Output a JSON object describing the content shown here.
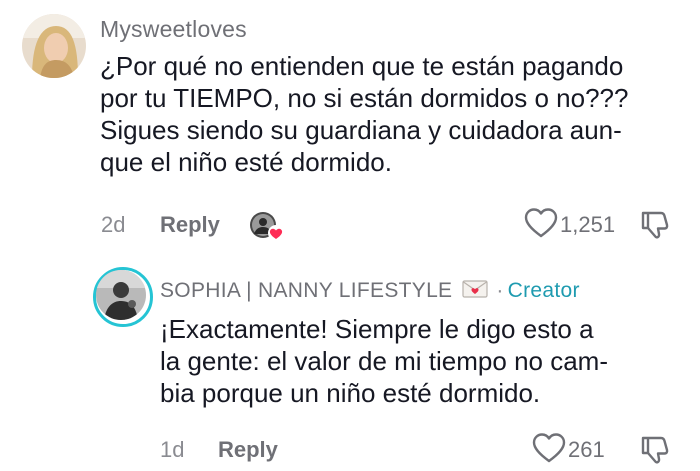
{
  "comment": {
    "username": "Mysweetloves",
    "text_lines": [
      "¿Por qué no entienden que te están pagando",
      "por tu TIEMPO, no si están dormidos o no???",
      "Sigues siendo su guardiana y cuidadora aun-",
      "que el niño esté dormido."
    ],
    "age": "2d",
    "reply_label": "Reply",
    "like_count": "1,251",
    "icons": {
      "like": "heart-outline-icon",
      "dislike": "thumbs-down-icon",
      "creator_liked": "creator-liked-badge-icon"
    }
  },
  "reply": {
    "username": "SOPHIA | NANNY LIFESTYLE",
    "separator": "·",
    "badge": "Creator",
    "text_lines": [
      "¡Exactamente! Siempre le digo esto a",
      "la gente: el valor de mi tiempo no cam-",
      "bia porque un niño esté dormido."
    ],
    "age": "1d",
    "reply_label": "Reply",
    "like_count": "261",
    "icons": {
      "envelope": "love-letter-icon",
      "like": "heart-outline-icon",
      "dislike": "thumbs-down-icon"
    }
  },
  "colors": {
    "creator_accent": "#1f9bb0",
    "ring": "#25c4d4",
    "heart": "#fe2c55",
    "text": "#161823",
    "muted": "#8a8b91"
  }
}
